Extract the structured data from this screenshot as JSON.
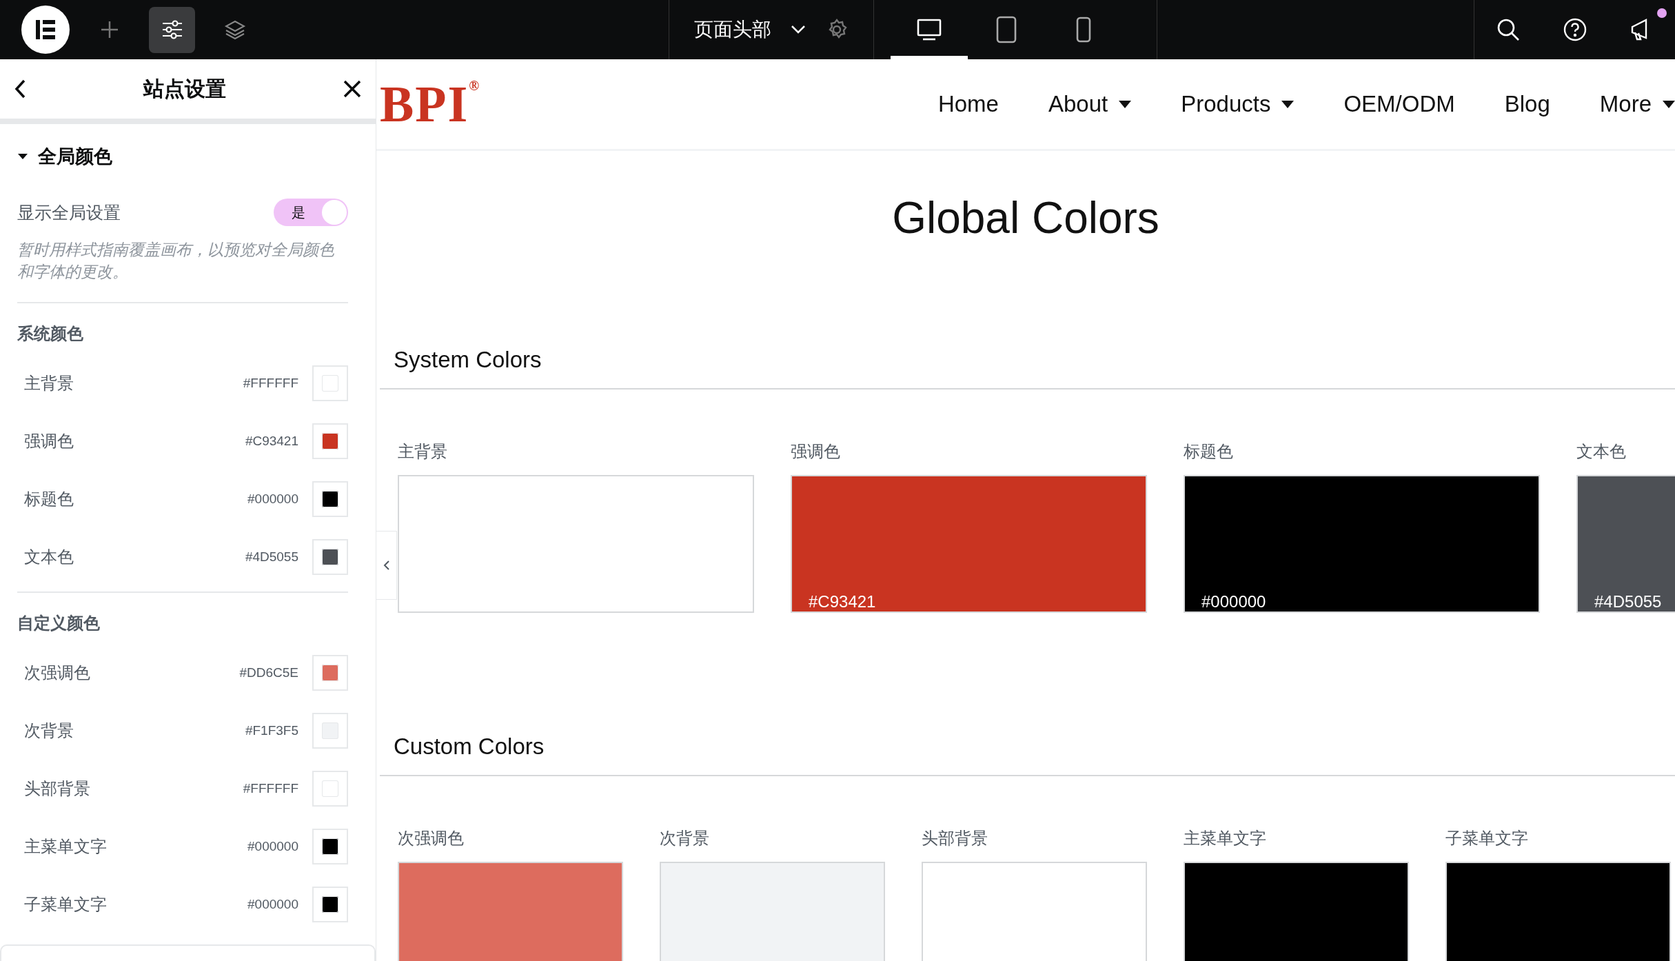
{
  "topbar": {
    "tools": [
      {
        "kind": "add",
        "selected": false
      },
      {
        "kind": "settings",
        "selected": true
      },
      {
        "kind": "layers",
        "selected": false
      }
    ],
    "document_title": "页面头部",
    "devices": [
      {
        "kind": "desktop",
        "selected": true
      },
      {
        "kind": "tablet",
        "selected": false
      },
      {
        "kind": "mobile",
        "selected": false
      }
    ],
    "notification": true
  },
  "sidebar": {
    "title": "站点设置",
    "section": {
      "title": "全局颜色",
      "expanded": true
    },
    "toggle": {
      "label": "显示全局设置",
      "on": true,
      "state_text": "是"
    },
    "hint": "暂时用样式指南覆盖画布，以预览对全局颜色和字体的更改。",
    "groups": [
      {
        "title": "系统颜色",
        "colors": [
          {
            "name": "主背景",
            "hex": "#FFFFFF",
            "color": "#ffffff"
          },
          {
            "name": "强调色",
            "hex": "#C93421",
            "color": "#c93421"
          },
          {
            "name": "标题色",
            "hex": "#000000",
            "color": "#000000"
          },
          {
            "name": "文本色",
            "hex": "#4D5055",
            "color": "#4d5055"
          }
        ]
      },
      {
        "title": "自定义颜色",
        "colors": [
          {
            "name": "次强调色",
            "hex": "#DD6C5E",
            "color": "#dd6c5e"
          },
          {
            "name": "次背景",
            "hex": "#F1F3F5",
            "color": "#f1f3f5"
          },
          {
            "name": "头部背景",
            "hex": "#FFFFFF",
            "color": "#ffffff"
          },
          {
            "name": "主菜单文字",
            "hex": "#000000",
            "color": "#000000"
          },
          {
            "name": "子菜单文字",
            "hex": "#000000",
            "color": "#000000"
          }
        ]
      }
    ]
  },
  "preview": {
    "logo": {
      "text": "BPI",
      "mark": "®"
    },
    "nav": [
      {
        "label": "Home",
        "dropdown": false
      },
      {
        "label": "About",
        "dropdown": true
      },
      {
        "label": "Products",
        "dropdown": true
      },
      {
        "label": "OEM/ODM",
        "dropdown": false
      },
      {
        "label": "Blog",
        "dropdown": false
      },
      {
        "label": "More",
        "dropdown": true
      }
    ],
    "title": "Global Colors",
    "sections": [
      {
        "title": "System Colors",
        "swatches": [
          {
            "label": "主背景",
            "color": "#ffffff"
          },
          {
            "label": "强调色",
            "color": "#c93421",
            "caption": "#C93421"
          },
          {
            "label": "标题色",
            "color": "#000000",
            "caption": "#000000"
          },
          {
            "label": "文本色",
            "color": "#4d5055",
            "caption": "#4D5055"
          }
        ]
      },
      {
        "title": "Custom Colors",
        "swatches": [
          {
            "label": "次强调色",
            "color": "#dd6c5e"
          },
          {
            "label": "次背景",
            "color": "#f1f3f5"
          },
          {
            "label": "头部背景",
            "color": "#ffffff"
          },
          {
            "label": "主菜单文字",
            "color": "#000000"
          },
          {
            "label": "子菜单文字",
            "color": "#000000"
          }
        ]
      }
    ]
  }
}
